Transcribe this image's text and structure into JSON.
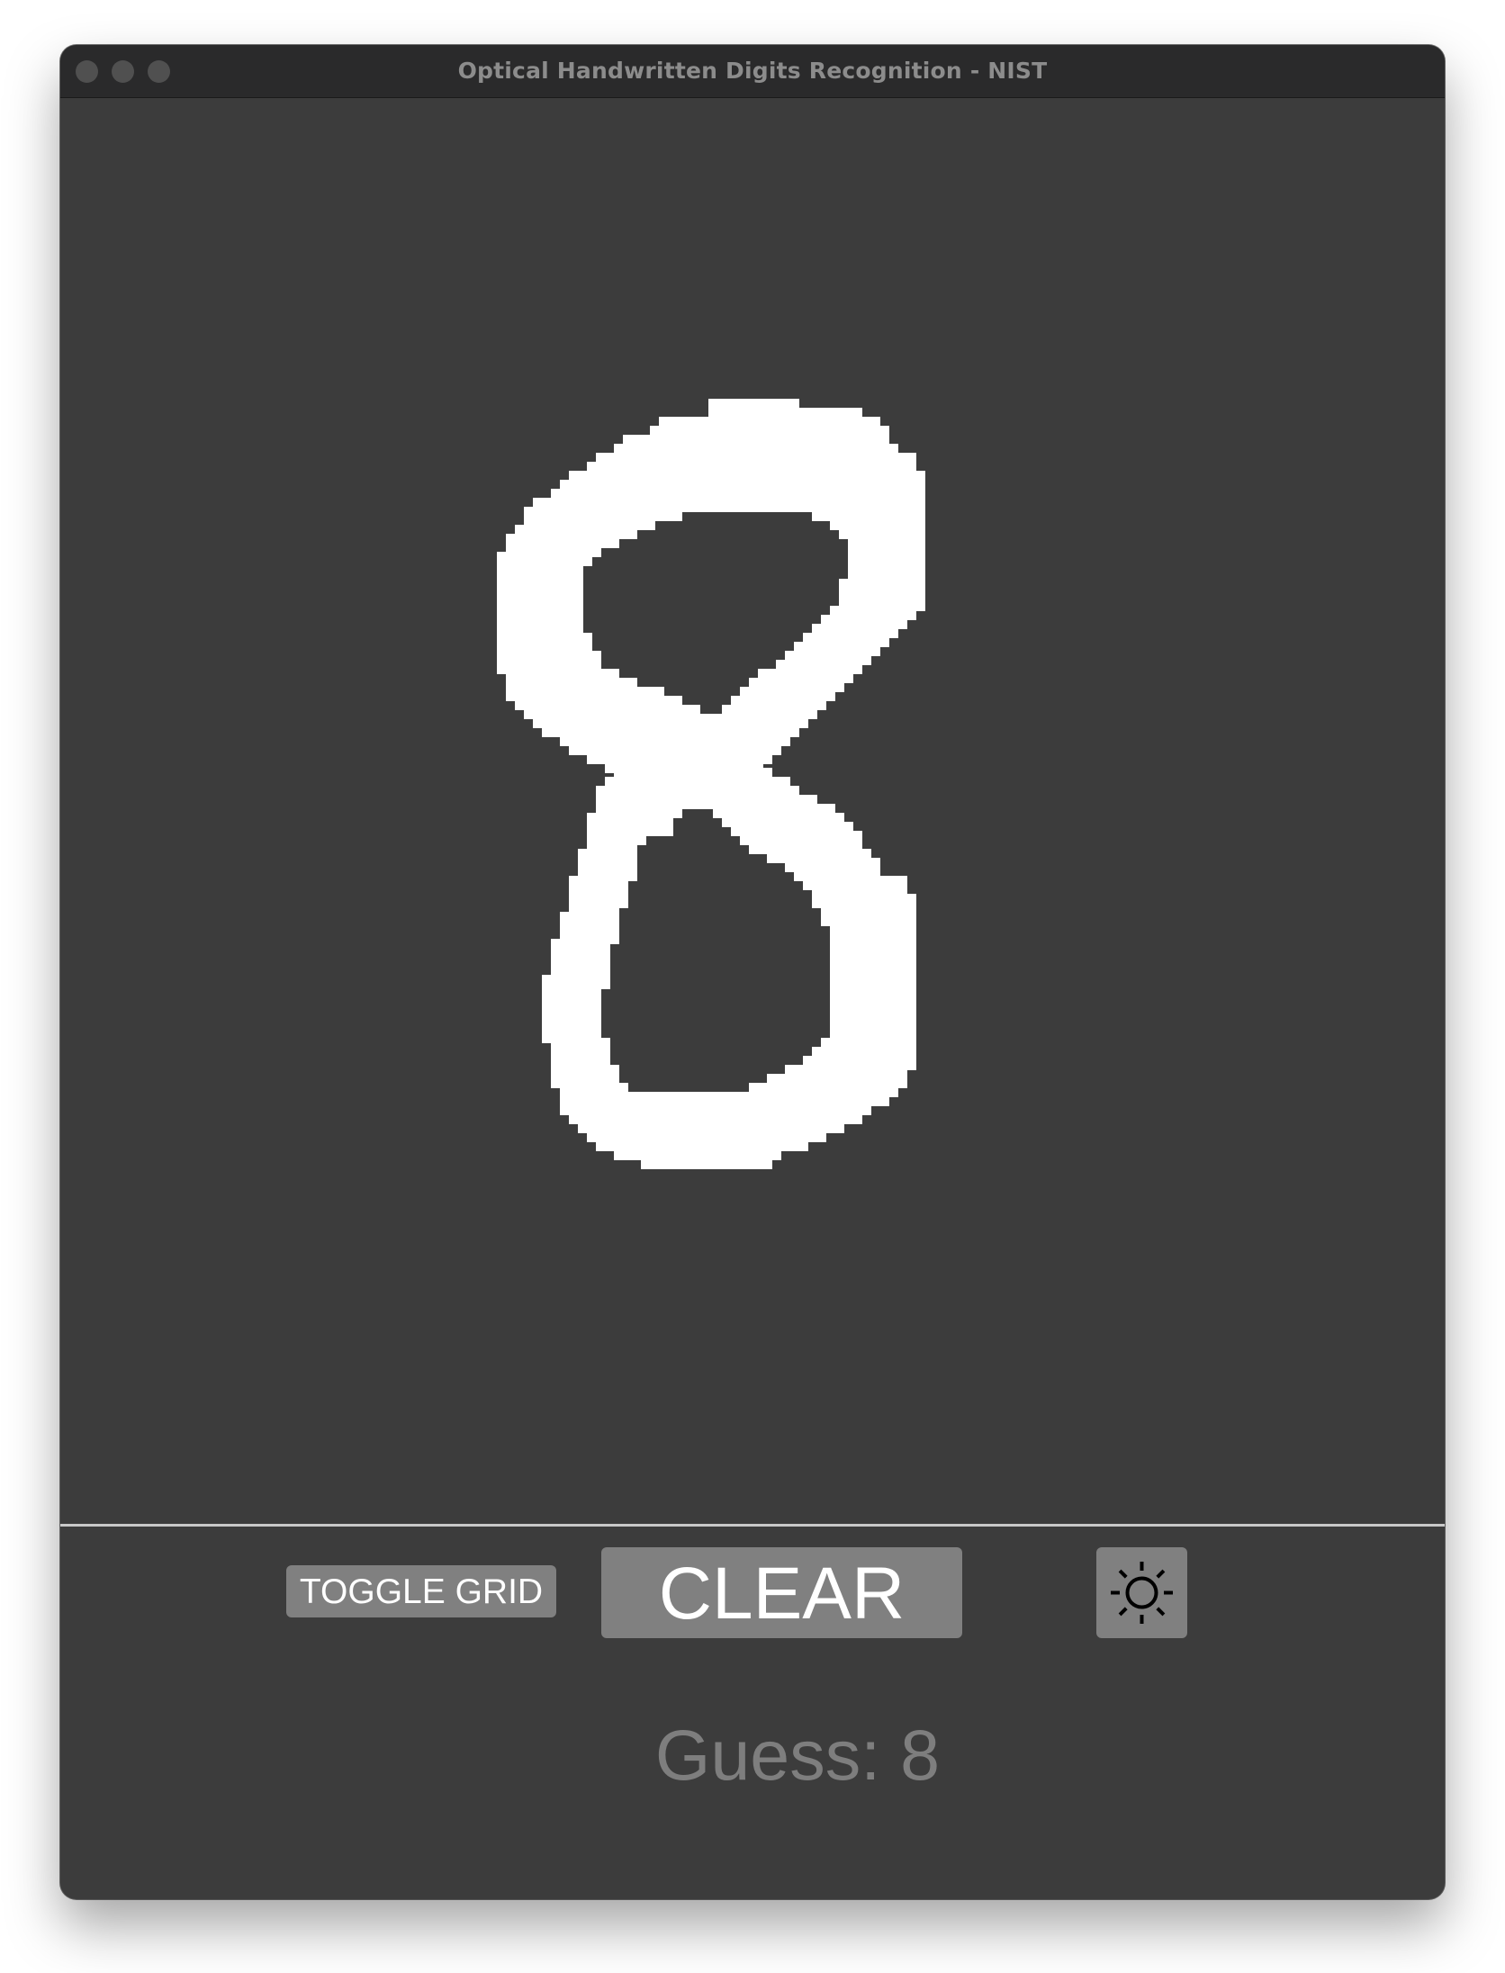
{
  "window": {
    "title": "Optical Handwritten Digits Recognition - NIST"
  },
  "canvas": {
    "drawn_digit": "8",
    "background_color": "#3c3c3c",
    "stroke_color": "#ffffff"
  },
  "controls": {
    "toggle_grid_label": "TOGGLE GRID",
    "clear_label": "CLEAR",
    "theme_icon": "sun-icon",
    "button_color": "#808080"
  },
  "result": {
    "guess_label": "Guess: 8"
  }
}
